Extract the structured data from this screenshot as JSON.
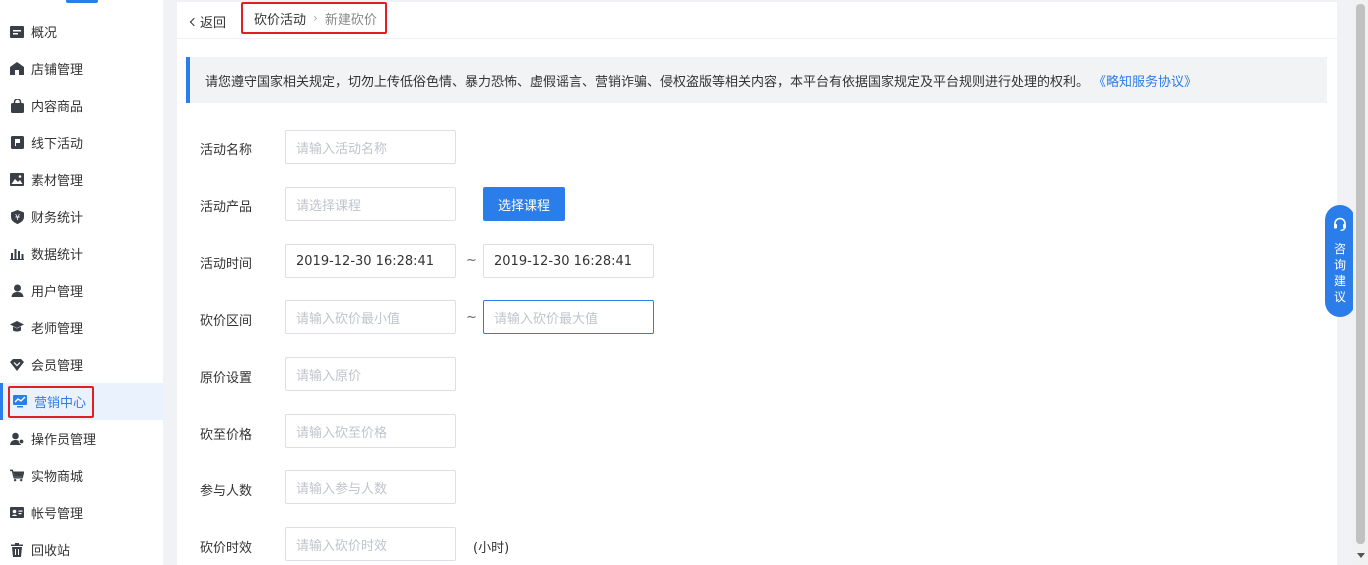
{
  "sidebar": {
    "items": [
      {
        "label": "概况",
        "icon": "overview-icon"
      },
      {
        "label": "店铺管理",
        "icon": "store-icon"
      },
      {
        "label": "内容商品",
        "icon": "bag-icon"
      },
      {
        "label": "线下活动",
        "icon": "flag-icon"
      },
      {
        "label": "素材管理",
        "icon": "image-icon"
      },
      {
        "label": "财务统计",
        "icon": "finance-icon"
      },
      {
        "label": "数据统计",
        "icon": "chart-icon"
      },
      {
        "label": "用户管理",
        "icon": "user-icon"
      },
      {
        "label": "老师管理",
        "icon": "teacher-icon"
      },
      {
        "label": "会员管理",
        "icon": "member-icon"
      },
      {
        "label": "营销中心",
        "icon": "marketing-icon",
        "active": true
      },
      {
        "label": "操作员管理",
        "icon": "operator-icon"
      },
      {
        "label": "实物商城",
        "icon": "cart-icon"
      },
      {
        "label": "帐号管理",
        "icon": "account-card-icon"
      },
      {
        "label": "回收站",
        "icon": "trash-icon"
      }
    ]
  },
  "header": {
    "back_label": "返回",
    "breadcrumb": [
      "砍价活动",
      "新建砍价"
    ],
    "breadcrumb_sep": "›"
  },
  "notice": {
    "text": "请您遵守国家相关规定，切勿上传低俗色情、暴力恐怖、虚假谣言、营销诈骗、侵权盗版等相关内容，本平台有依据国家规定及平台规则进行处理的权利。",
    "link": "《略知服务协议》"
  },
  "form": {
    "name": {
      "label": "活动名称",
      "placeholder": "请输入活动名称"
    },
    "product": {
      "label": "活动产品",
      "placeholder": "请选择课程",
      "button": "选择课程"
    },
    "time": {
      "label": "活动时间",
      "start": "2019-12-30 16:28:41",
      "end": "2019-12-30 16:28:41",
      "sep": "~"
    },
    "range": {
      "label": "砍价区间",
      "min_placeholder": "请输入砍价最小值",
      "max_placeholder": "请输入砍价最大值",
      "sep": "~"
    },
    "original": {
      "label": "原价设置",
      "placeholder": "请输入原价"
    },
    "target": {
      "label": "砍至价格",
      "placeholder": "请输入砍至价格"
    },
    "participants": {
      "label": "参与人数",
      "placeholder": "请输入参与人数"
    },
    "duration": {
      "label": "砍价时效",
      "placeholder": "请输入砍价时效",
      "unit": "(小时)"
    }
  },
  "consult": {
    "label": "咨询建议",
    "icon": "headset-icon"
  },
  "colors": {
    "accent": "#2b7de9",
    "highlight": "#e02020"
  }
}
